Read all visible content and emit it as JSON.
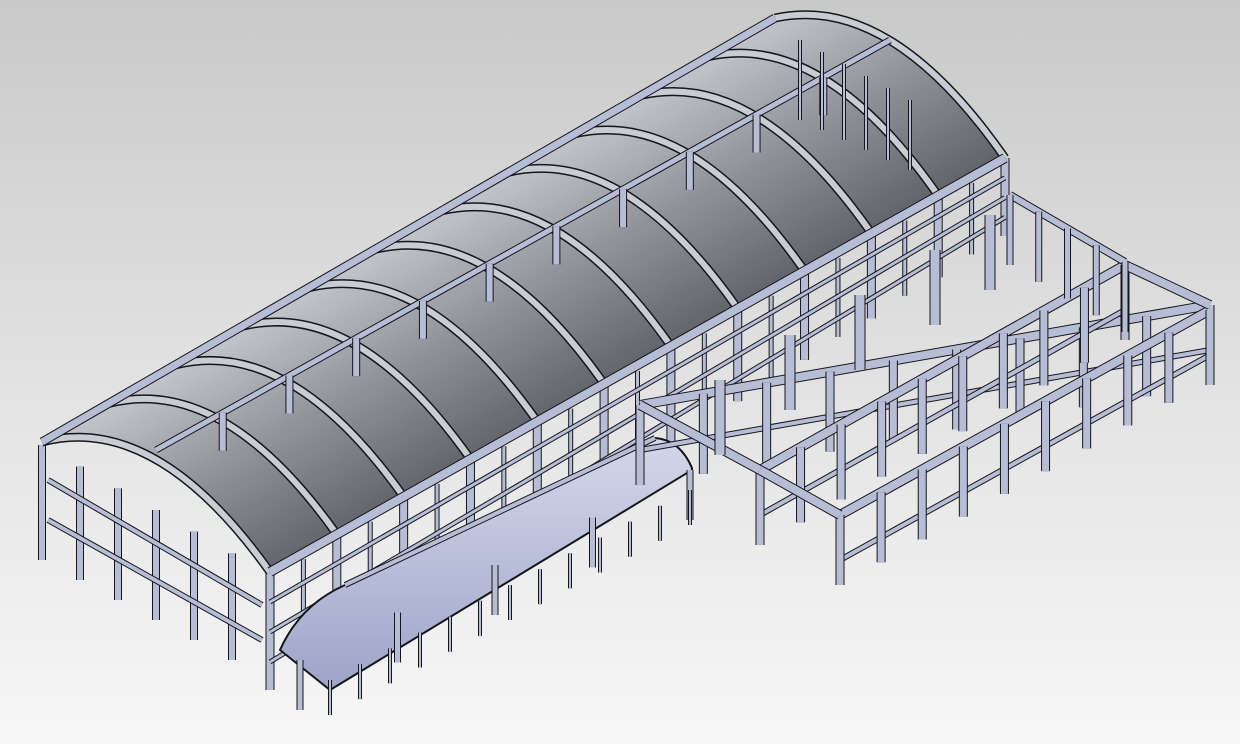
{
  "scene": {
    "background_top": "#c9c9c9",
    "background_bottom": "#f7f7f7",
    "main_hall": {
      "arch_count": 11
    },
    "side_wing": {
      "frame_count": 3
    },
    "colors": {
      "steel": "#b8bdd6",
      "steel_dark": "#3a3c44",
      "outline": "#15161b",
      "roof_light": "#c9ccd2",
      "roof_dark": "#55575d",
      "glass_blue": "#aeb4d8"
    }
  }
}
